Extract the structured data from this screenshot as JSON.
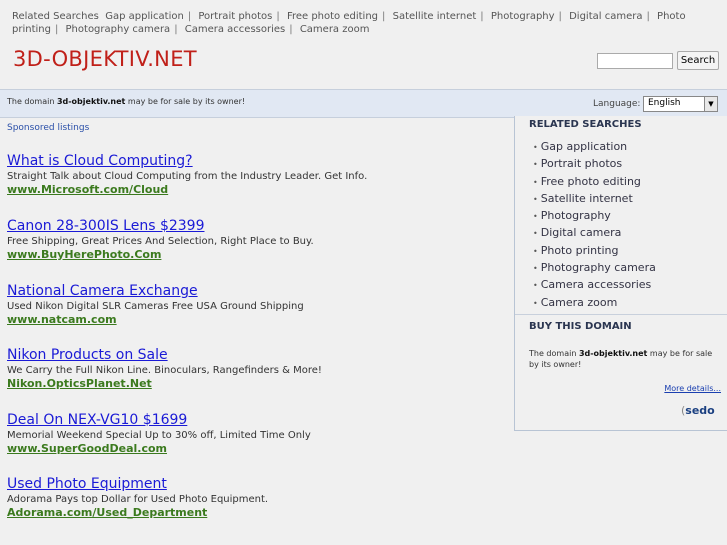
{
  "topnav": {
    "label": "Related Searches",
    "items": [
      "Gap application",
      "Portrait photos",
      "Free photo editing",
      "Satellite internet",
      "Photography",
      "Digital camera",
      "Photo printing",
      "Photography camera",
      "Camera accessories",
      "Camera zoom"
    ]
  },
  "header": {
    "logo": "3D-OBJEKTIV.NET",
    "search_button": "Search",
    "search_value": ""
  },
  "sale_bar": {
    "prefix": "The domain",
    "domain": "3d-objektiv.net",
    "suffix": "may be for sale by its owner!",
    "language_label": "Language:",
    "language_value": "English"
  },
  "sponsored_label": "Sponsored listings",
  "ads": [
    {
      "title": "What is Cloud Computing?",
      "desc": "Straight Talk about Cloud Computing from the Industry Leader. Get Info.",
      "url": "www.Microsoft.com/Cloud"
    },
    {
      "title": "Canon 28-300IS Lens $2399",
      "desc": "Free Shipping, Great Prices And Selection, Right Place to Buy.",
      "url": "www.BuyHerePhoto.Com"
    },
    {
      "title": "National Camera Exchange",
      "desc": "Used Nikon Digital SLR Cameras Free USA Ground Shipping",
      "url": "www.natcam.com"
    },
    {
      "title": "Nikon Products on Sale",
      "desc": "We Carry the Full Nikon Line. Binoculars, Rangefinders & More!",
      "url": "Nikon.OpticsPlanet.Net"
    },
    {
      "title": "Deal On NEX-VG10 $1699",
      "desc": "Memorial Weekend Special Up to 30% off, Limited Time Only",
      "url": "www.SuperGoodDeal.com"
    },
    {
      "title": "Used Photo Equipment",
      "desc": "Adorama Pays top Dollar for Used Photo Equipment.",
      "url": "Adorama.com/Used_Department"
    }
  ],
  "related": {
    "heading": "RELATED SEARCHES",
    "items": [
      "Gap application",
      "Portrait photos",
      "Free photo editing",
      "Satellite internet",
      "Photography",
      "Digital camera",
      "Photo printing",
      "Photography camera",
      "Camera accessories",
      "Camera zoom"
    ]
  },
  "buy": {
    "heading": "BUY THIS DOMAIN",
    "prefix": "The domain",
    "domain": "3d-objektiv.net",
    "suffix": "may be for sale by its owner!",
    "more_details": "More details...",
    "logo_text": "sedo"
  },
  "colors": {
    "logo": "#c02019",
    "ad_title": "#1a1ad6",
    "ad_url": "#3b7a1e",
    "sale_bar_bg": "#e1e8f3"
  }
}
